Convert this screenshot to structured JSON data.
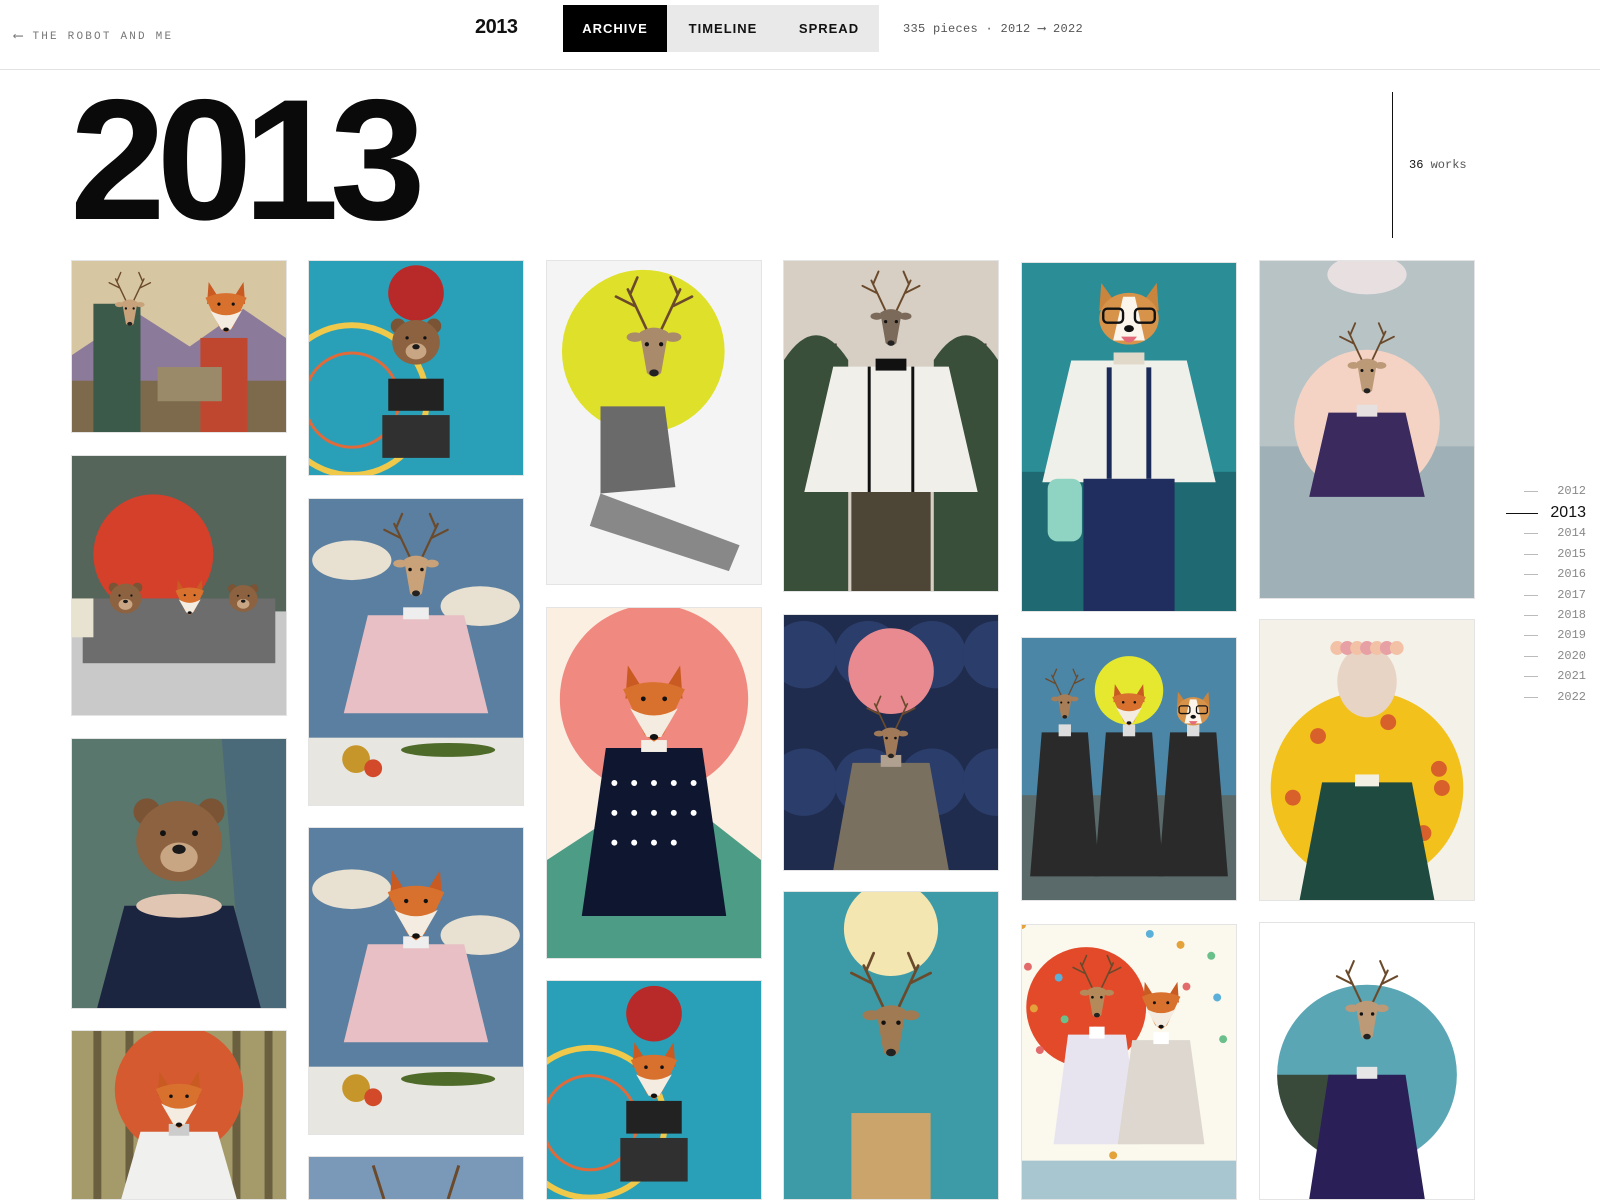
{
  "nav": {
    "back_arrow": "⟵",
    "back_label": "THE ROBOT AND ME"
  },
  "header": {
    "year": "2013",
    "tabs": [
      {
        "label": "ARCHIVE",
        "active": true
      },
      {
        "label": "TIMELINE"
      },
      {
        "label": "SPREAD"
      }
    ],
    "meta": "335 pieces · 2012 ⟶ 2022"
  },
  "section": {
    "year": "2013",
    "count": "36",
    "count_suffix": " works"
  },
  "year_nav": [
    "2012",
    "2013",
    "2014",
    "2015",
    "2016",
    "2017",
    "2018",
    "2019",
    "2020",
    "2021",
    "2022"
  ],
  "active_year": "2013",
  "artworks": [
    {
      "subject": "deer-couple-office-collage",
      "bg": "#3b5a4a",
      "accent": "#c8a27a"
    },
    {
      "subject": "bear-ferris-wheel-collage",
      "bg": "#2aa0b8",
      "accent": "#b82a2a"
    },
    {
      "subject": "deer-yellow-sun-pinup",
      "bg": "#f4f4f4",
      "accent": "#dfe02a"
    },
    {
      "subject": "deer-glasses-forest",
      "bg": "#8a6f5a",
      "accent": "#f1efe9"
    },
    {
      "subject": "corgi-glasses-suspenders",
      "bg": "#2b8d96",
      "accent": "#f0f0ea"
    },
    {
      "subject": "deer-purple-jacket-sea",
      "bg": "#b8c3c6",
      "accent": "#f4d3c4"
    },
    {
      "subject": "animals-red-sun-street",
      "bg": "#55655a",
      "accent": "#d4402a"
    },
    {
      "subject": "deer-kitchen-cucumber",
      "bg": "#5a7fa0",
      "accent": "#e8bfc4"
    },
    {
      "subject": "fox-polka-dot-dress",
      "bg": "#fbefe2",
      "accent": "#f08a80"
    },
    {
      "subject": "deer-flower-head-roses",
      "bg": "#1f2c4e",
      "accent": "#e88a90"
    },
    {
      "subject": "three-gentlemen-sea",
      "bg": "#4b86a6",
      "accent": "#e6e830"
    },
    {
      "subject": "cat-flower-crown-yellow",
      "bg": "#f4f1e8",
      "accent": "#f2c11b"
    },
    {
      "subject": "bear-swimsuit-forest",
      "bg": "#59776d",
      "accent": "#a07650"
    },
    {
      "subject": "fox-kitchen-cucumber",
      "bg": "#5a7fa0",
      "accent": "#e8bfc4"
    },
    {
      "subject": "fox-ferris-wheel-collage",
      "bg": "#2aa0b8",
      "accent": "#b82a2a"
    },
    {
      "subject": "roe-deer-flowers-teal",
      "bg": "#3d9ba8",
      "accent": "#f3e6b0"
    },
    {
      "subject": "deer-fox-skaters-confetti",
      "bg": "#fbf8ee",
      "accent": "#e34a2a"
    },
    {
      "subject": "deer-purple-jacket-circle",
      "bg": "#ffffff",
      "accent": "#5aa6b4"
    },
    {
      "subject": "squirrel-red-sun-forest",
      "bg": "#a49a6a",
      "accent": "#d55a30"
    },
    {
      "subject": "deer-partial",
      "bg": "#7a98b8",
      "accent": "#c4a080"
    }
  ]
}
